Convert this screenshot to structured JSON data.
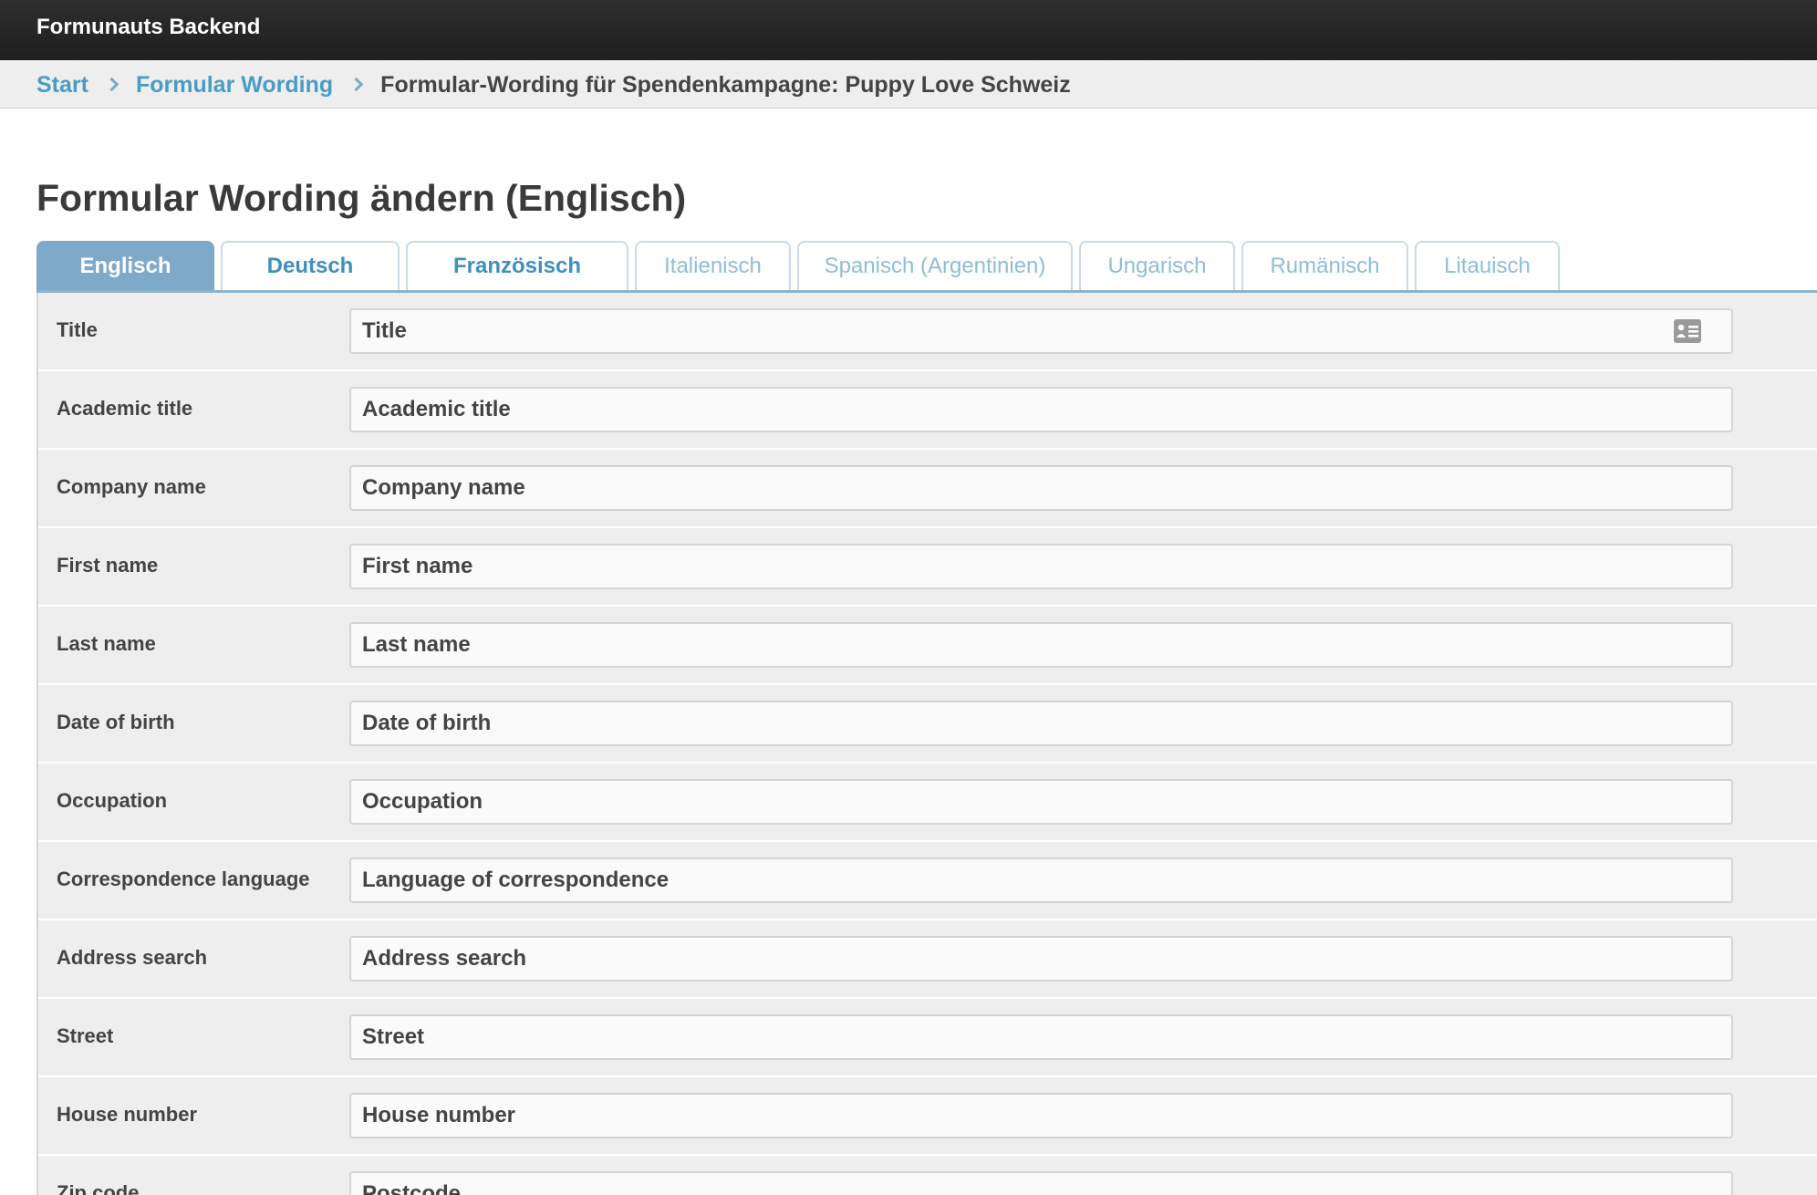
{
  "app": {
    "title": "Formunauts Backend"
  },
  "breadcrumb": [
    {
      "label": "Start"
    },
    {
      "label": "Formular Wording"
    },
    {
      "label": "Formular-Wording für Spendenkampagne: Puppy Love Schweiz"
    }
  ],
  "page": {
    "title": "Formular Wording ändern (Englisch)"
  },
  "tabs": [
    {
      "label": "Englisch",
      "state": "active"
    },
    {
      "label": "Deutsch",
      "state": "strong"
    },
    {
      "label": "Französisch",
      "state": "strong"
    },
    {
      "label": "Italienisch",
      "state": "light"
    },
    {
      "label": "Spanisch (Argentinien)",
      "state": "light"
    },
    {
      "label": "Ungarisch",
      "state": "light"
    },
    {
      "label": "Rumänisch",
      "state": "light"
    },
    {
      "label": "Litauisch",
      "state": "light"
    }
  ],
  "fields": [
    {
      "label": "Title",
      "value": "Title",
      "icon": "contact-card-icon"
    },
    {
      "label": "Academic title",
      "value": "Academic title"
    },
    {
      "label": "Company name",
      "value": "Company name"
    },
    {
      "label": "First name",
      "value": "First name"
    },
    {
      "label": "Last name",
      "value": "Last name"
    },
    {
      "label": "Date of birth",
      "value": "Date of birth"
    },
    {
      "label": "Occupation",
      "value": "Occupation"
    },
    {
      "label": "Correspondence language",
      "value": "Language of correspondence"
    },
    {
      "label": "Address search",
      "value": "Address search"
    },
    {
      "label": "Street",
      "value": "Street"
    },
    {
      "label": "House number",
      "value": "House number"
    },
    {
      "label": "Zip code",
      "value": "Postcode"
    }
  ],
  "colors": {
    "topbar": "#1f1f1f",
    "link": "#4a9cc4",
    "active_tab": "#7fa9c9",
    "form_background": "#eeeeee"
  }
}
